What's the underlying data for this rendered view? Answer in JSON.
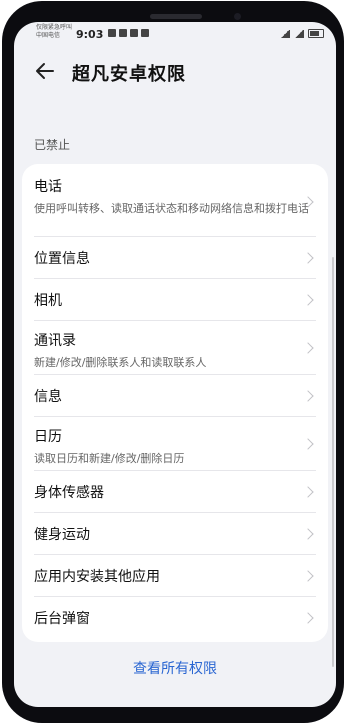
{
  "status_bar": {
    "carrier_line1": "仅限紧急呼叫",
    "carrier_line2": "中国电信",
    "time": "9:03"
  },
  "header": {
    "title": "超凡安卓权限",
    "back_icon": "back-arrow-icon"
  },
  "section": {
    "label": "已禁止"
  },
  "permissions": [
    {
      "title": "电话",
      "subtitle": "使用呼叫转移、读取通话状态和移动网络信息和拨打电话"
    },
    {
      "title": "位置信息",
      "subtitle": ""
    },
    {
      "title": "相机",
      "subtitle": ""
    },
    {
      "title": "通讯录",
      "subtitle": "新建/修改/删除联系人和读取联系人"
    },
    {
      "title": "信息",
      "subtitle": ""
    },
    {
      "title": "日历",
      "subtitle": "读取日历和新建/修改/删除日历"
    },
    {
      "title": "身体传感器",
      "subtitle": ""
    },
    {
      "title": "健身运动",
      "subtitle": ""
    },
    {
      "title": "应用内安装其他应用",
      "subtitle": ""
    },
    {
      "title": "后台弹窗",
      "subtitle": ""
    }
  ],
  "footer": {
    "view_all_label": "查看所有权限"
  },
  "colors": {
    "accent": "#2a66d2",
    "background": "#f1f2f6",
    "card": "#ffffff"
  }
}
